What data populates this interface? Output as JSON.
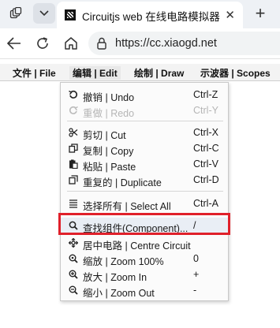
{
  "browser": {
    "tab_title": "Circuitjs web 在线电路模拟器",
    "url": "https://cc.xiaogd.net"
  },
  "menubar": {
    "file": "文件 | File",
    "edit": "编辑 | Edit",
    "draw": "绘制 | Draw",
    "scopes": "示波器 | Scopes"
  },
  "edit_menu": {
    "items": [
      {
        "label": "撤销 | Undo",
        "shortcut": "Ctrl-Z",
        "icon": "undo-icon",
        "enabled": true
      },
      {
        "label": "重做 | Redo",
        "shortcut": "Ctrl-Y",
        "icon": "redo-icon",
        "enabled": false
      },
      {
        "label": "剪切 | Cut",
        "shortcut": "Ctrl-X",
        "icon": "scissors-icon",
        "enabled": true
      },
      {
        "label": "复制 | Copy",
        "shortcut": "Ctrl-C",
        "icon": "copy-icon",
        "enabled": true
      },
      {
        "label": "粘贴 | Paste",
        "shortcut": "Ctrl-V",
        "icon": "paste-icon",
        "enabled": true
      },
      {
        "label": "重复的 | Duplicate",
        "shortcut": "Ctrl-D",
        "icon": "duplicate-icon",
        "enabled": true
      },
      {
        "label": "选择所有 | Select All",
        "shortcut": "Ctrl-A",
        "icon": "select-all-icon",
        "enabled": true
      },
      {
        "label": "查找组件(Component)...",
        "shortcut": "/",
        "icon": "search-icon",
        "enabled": true,
        "highlighted": true
      },
      {
        "label": "居中电路 | Centre Circuit",
        "shortcut": "",
        "icon": "move-icon",
        "enabled": true
      },
      {
        "label": "缩放 | Zoom 100%",
        "shortcut": "0",
        "icon": "zoom-icon",
        "enabled": true
      },
      {
        "label": "放大 | Zoom In",
        "shortcut": "+",
        "icon": "zoom-in-icon",
        "enabled": true
      },
      {
        "label": "缩小 | Zoom Out",
        "shortcut": "-",
        "icon": "zoom-out-icon",
        "enabled": true
      }
    ]
  },
  "colors": {
    "highlight_border": "#e0202a"
  }
}
